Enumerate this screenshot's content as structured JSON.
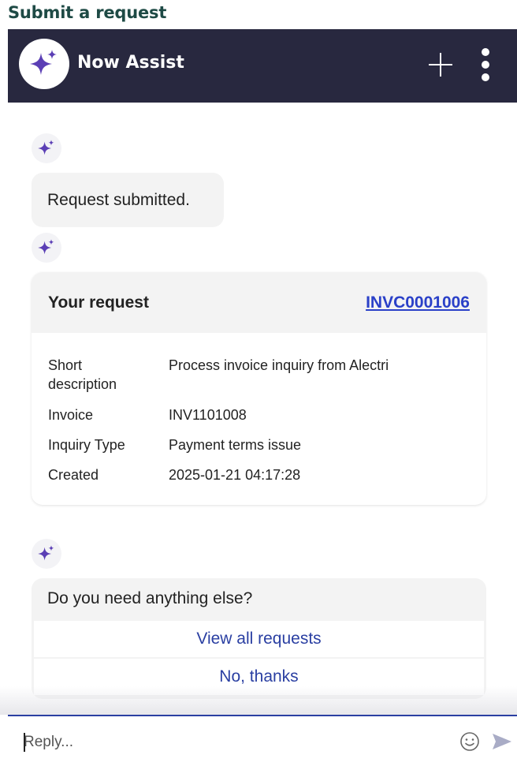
{
  "page": {
    "title": "Submit a request"
  },
  "header": {
    "title": "Now Assist",
    "logo_icon": "sparkle-icon",
    "new_chat_icon": "plus-icon",
    "menu_icon": "more-vertical-icon",
    "background_color": "#28283f"
  },
  "conversation": {
    "status_message": "Request submitted.",
    "request_card": {
      "title": "Your request",
      "number": "INVC0001006",
      "rows": [
        {
          "label": "Short description",
          "value": "Process invoice inquiry from Alectri"
        },
        {
          "label": "Invoice",
          "value": "INV1101008"
        },
        {
          "label": "Inquiry Type",
          "value": "Payment terms issue"
        },
        {
          "label": "Created",
          "value": "2025-01-21 04:17:28"
        }
      ]
    },
    "followup": {
      "question": "Do you need anything else?",
      "options": [
        {
          "label": "View all requests"
        },
        {
          "label": "No, thanks"
        }
      ]
    }
  },
  "composer": {
    "placeholder": "Reply...",
    "emoji_icon": "smiley-icon",
    "send_icon": "send-icon"
  },
  "colors": {
    "accent": "#2a3fa2",
    "link": "#2a40c8",
    "sparkle": "#5b3fb5",
    "title": "#1e4a45"
  }
}
